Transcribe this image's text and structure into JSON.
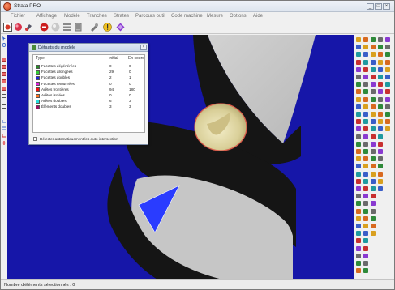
{
  "window": {
    "title": "Strata PRO",
    "minimize_label": "_",
    "maximize_label": "□",
    "close_label": "×"
  },
  "menu": [
    "Fichier",
    "Affichage",
    "Modèle",
    "Tranches",
    "Strates",
    "Parcours outil",
    "Code machine",
    "Mesure",
    "Options",
    "Aide"
  ],
  "toolbar": {
    "icons": [
      "open-icon",
      "color-sphere-icon",
      "paint-icon",
      "stop-icon",
      "shade-sphere-icon",
      "slices-icon",
      "layers-icon",
      "tools-icon",
      "warning-icon",
      "diamond-icon"
    ]
  },
  "defects_dialog": {
    "title": "Défauts du modèle",
    "close_label": "×",
    "columns": [
      "Type",
      "Initial",
      "En cours"
    ],
    "rows": [
      {
        "label": "Facettes dégénérées",
        "initial": "0",
        "current": "0",
        "color": "#2b8a2b"
      },
      {
        "label": "Facettes allongées",
        "initial": "29",
        "current": "0",
        "color": "#33cc33"
      },
      {
        "label": "Facettes doubles",
        "initial": "2",
        "current": "1",
        "color": "#2222dd"
      },
      {
        "label": "Facettes retournées",
        "initial": "0",
        "current": "0",
        "color": "#dd22dd"
      },
      {
        "label": "Arêtes frontières",
        "initial": "94",
        "current": "180",
        "color": "#ee1111"
      },
      {
        "label": "Arêtes isolées",
        "initial": "0",
        "current": "0",
        "color": "#ff7722"
      },
      {
        "label": "Arêtes doubles",
        "initial": "6",
        "current": "3",
        "color": "#22dddd"
      },
      {
        "label": "Éléments doubles",
        "initial": "3",
        "current": "3",
        "color": "#991166"
      }
    ],
    "auto_detect_label": "Détecter automatiquement les auto-intersection",
    "auto_detect_checked": false
  },
  "status": {
    "text": "Nombre d'éléments sélectionnés : 0"
  },
  "colors": {
    "viewport_background": "#1616a8",
    "model_dark": "#141414",
    "model_light": "#c4c4c4",
    "hole_face": "#e8e0b0",
    "defect_triangle": "#2a3cff"
  }
}
